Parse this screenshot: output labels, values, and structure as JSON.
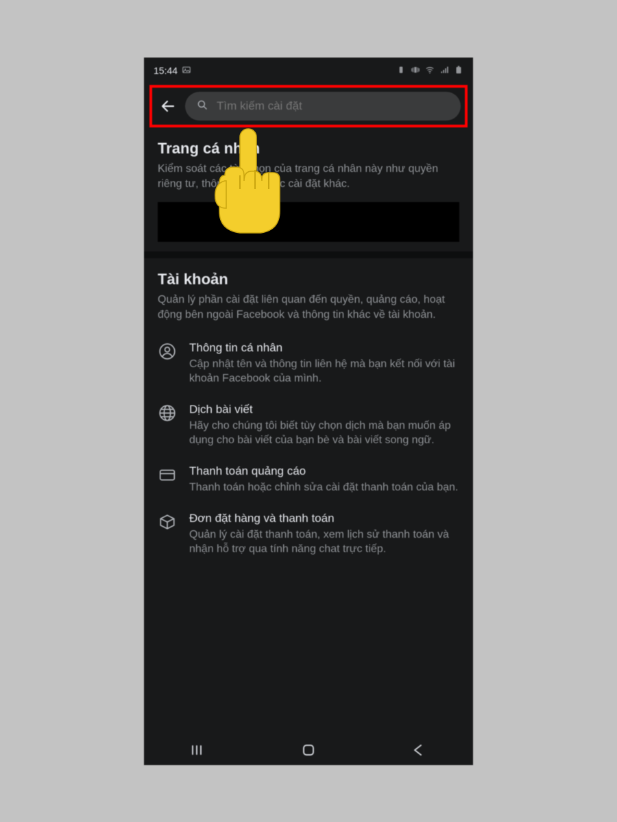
{
  "statusbar": {
    "time": "15:44"
  },
  "search": {
    "placeholder": "Tìm kiếm cài đặt"
  },
  "sections": {
    "profile": {
      "title": "Trang cá nhân",
      "desc": "Kiểm soát các tùy chọn của trang cá nhân này như quyền riêng tư, thông báo và các cài đặt khác."
    },
    "account": {
      "title": "Tài khoản",
      "desc": "Quản lý phần cài đặt liên quan đến quyền, quảng cáo, hoạt động bên ngoài Facebook và thông tin khác về tài khoản.",
      "items": [
        {
          "icon": "person",
          "title": "Thông tin cá nhân",
          "desc": "Cập nhật tên và thông tin liên hệ mà bạn kết nối với tài khoản Facebook của mình."
        },
        {
          "icon": "globe",
          "title": "Dịch bài viết",
          "desc": "Hãy cho chúng tôi biết tùy chọn dịch mà bạn muốn áp dụng cho bài viết của bạn bè và bài viết song ngữ."
        },
        {
          "icon": "card",
          "title": "Thanh toán quảng cáo",
          "desc": "Thanh toán hoặc chỉnh sửa cài đặt thanh toán của bạn."
        },
        {
          "icon": "box",
          "title": "Đơn đặt hàng và thanh toán",
          "desc": "Quản lý cài đặt thanh toán, xem lịch sử thanh toán và nhận hỗ trợ qua tính năng chat trực tiếp."
        }
      ]
    }
  }
}
